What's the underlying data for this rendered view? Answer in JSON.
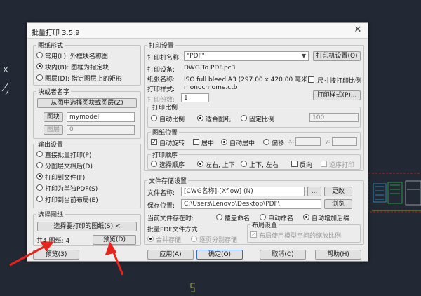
{
  "dialog_title": "批量打印 3.5.9",
  "left": {
    "graphic_format": {
      "label": "图纸形式",
      "options": [
        "常用(L): 外框块名称图",
        "块内(B): 图框为指定块",
        "图层(D): 指定图层上的矩形"
      ],
      "selected": 1
    },
    "block_layer": {
      "label": "块或者名字",
      "pick_button": "从图中选择图块或图层(Z)",
      "block_btn": "图块",
      "block_value": "mymodel",
      "layer_btn": "图层",
      "layer_value": "0"
    },
    "output": {
      "label": "输出设置",
      "options": [
        "直接批量打印(P)",
        "分图层文档后(D)",
        "打印到文件(F)",
        "打印为单独PDF(S)",
        "打印到当前布局(E)"
      ],
      "selected": 2
    },
    "select": {
      "label": "选择图纸",
      "select_btn": "选择要打印的图纸(S) <",
      "count_label": "共4 图纸: 4",
      "preview_btn": "预览(D)"
    }
  },
  "right": {
    "print_settings": {
      "label": "打印设置",
      "printer_label": "打印机名称:",
      "printer_value": "DWG To PDF.pc3",
      "printer_sel": "\"PDF\"",
      "printer_prop_btn": "打印机设置(O)",
      "paper_label": "纸张名称:",
      "paper_value": "ISO full bleed A3 (297.00 x 420.00 毫米)",
      "plot_style_label": "打印样式:",
      "plot_style_value": "monochrome.ctb",
      "plot_style_chk_label": "尺寸按打印比例",
      "print_scale_label": "打印份数:",
      "print_scale_value": "1",
      "plot_setup_btn": "打印样式(P)..."
    },
    "scale": {
      "label": "打印比例",
      "options": [
        "自动比例",
        "适合图纸",
        "固定比例"
      ],
      "selected": 1,
      "value": "100"
    },
    "position": {
      "label": "图纸位置",
      "auto_rotate": "自动旋转",
      "center": "居中",
      "auto_align": "自动居中",
      "offset": "偏移",
      "x_label": "x:",
      "y_label": "y:"
    },
    "order": {
      "label": "打印顺序",
      "options": [
        "选择顺序",
        "左右, 上下",
        "上下, 左右"
      ],
      "selected": 1,
      "reverse": "反向",
      "backward": "逆序打印"
    }
  },
  "file_settings": {
    "label": "文件存储设置",
    "filename_label": "文件名称:",
    "filename_value": "[CWG名称]-[Xflow] (N)",
    "browse_btn": "...",
    "rename_btn": "更改",
    "save_label": "保存位置:",
    "save_path": "C:\\Users\\Lenovo\\Desktop\\PDF\\",
    "browse_dir_btn": "浏览",
    "conflict_label": "当前文件存在时:",
    "conflict_options": [
      "覆盖命名",
      "自动命名",
      "自动增加后缀"
    ],
    "conflict_selected": 2,
    "merge_label": "批量PDF文件方式",
    "merge_options": [
      "合并存储",
      "逐页分别存储"
    ],
    "merge_selected": 0
  },
  "layout_settings": {
    "label": "布局设置",
    "checkbox": "布局使用模型空间的缩放比例"
  },
  "footer": {
    "preview": "预览(3)",
    "apply": "应用(A)",
    "ok": "确定(O)",
    "cancel": "取消(C)",
    "help": "帮助(H)"
  }
}
